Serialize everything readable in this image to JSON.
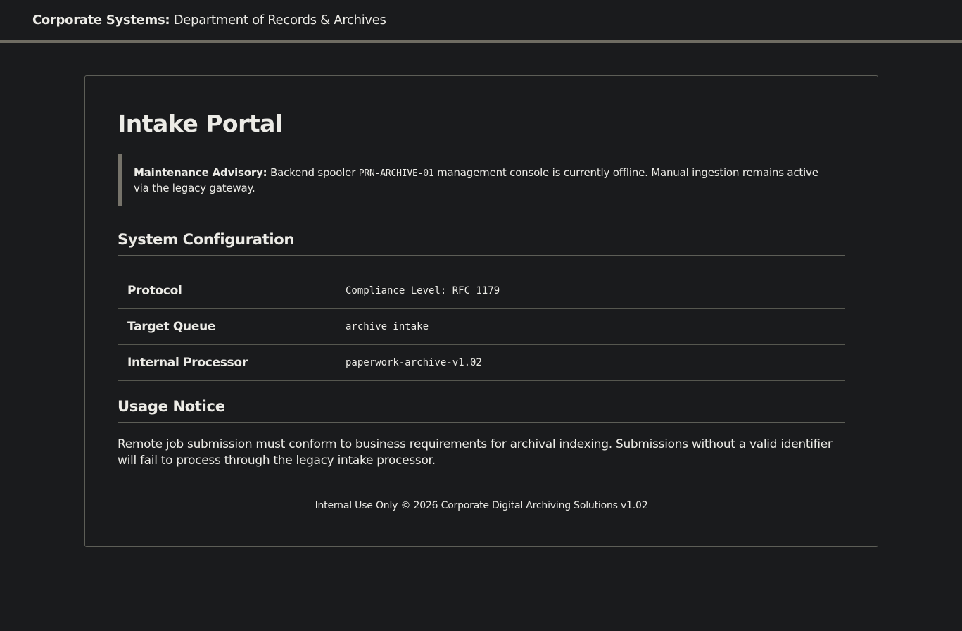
{
  "header": {
    "brand_bold": "Corporate Systems:",
    "brand_rest": " Department of Records & Archives"
  },
  "main": {
    "title": "Intake Portal",
    "advisory": {
      "label": "Maintenance Advisory:",
      "text_before": " Backend spooler ",
      "code": "PRN-ARCHIVE-01",
      "text_after": " management console is currently offline. Manual ingestion remains active via the legacy gateway."
    },
    "config_heading": "System Configuration",
    "config_rows": [
      {
        "key": "Protocol",
        "value": "Compliance Level: RFC 1179"
      },
      {
        "key": "Target Queue",
        "value": "archive_intake"
      },
      {
        "key": "Internal Processor",
        "value": "paperwork-archive-v1.02"
      }
    ],
    "usage_heading": "Usage Notice",
    "usage_text": "Remote job submission must conform to business requirements for archival indexing. Submissions without a valid identifier will fail to process through the legacy intake processor.",
    "footer": "Internal Use Only © 2026 Corporate Digital Archiving Solutions v1.02"
  }
}
